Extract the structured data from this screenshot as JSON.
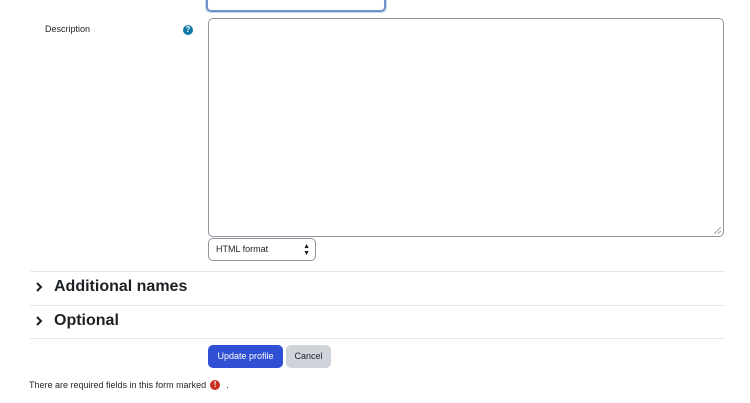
{
  "form": {
    "description_label": "Description",
    "help_icon": "question-circle-icon",
    "format_select": {
      "selected": "HTML format"
    }
  },
  "sections": [
    {
      "title": "Additional names",
      "icon": "chevron-right-icon"
    },
    {
      "title": "Optional",
      "icon": "chevron-right-icon"
    }
  ],
  "buttons": {
    "update": "Update profile",
    "cancel": "Cancel"
  },
  "footer": {
    "required_note": "There are required fields in this form marked",
    "required_note_end": ".",
    "required_icon": "exclamation-circle-icon"
  },
  "colors": {
    "primary": "#2f4fd4",
    "secondary": "#ced4da",
    "help": "#1177a8",
    "required": "#ca3120"
  }
}
